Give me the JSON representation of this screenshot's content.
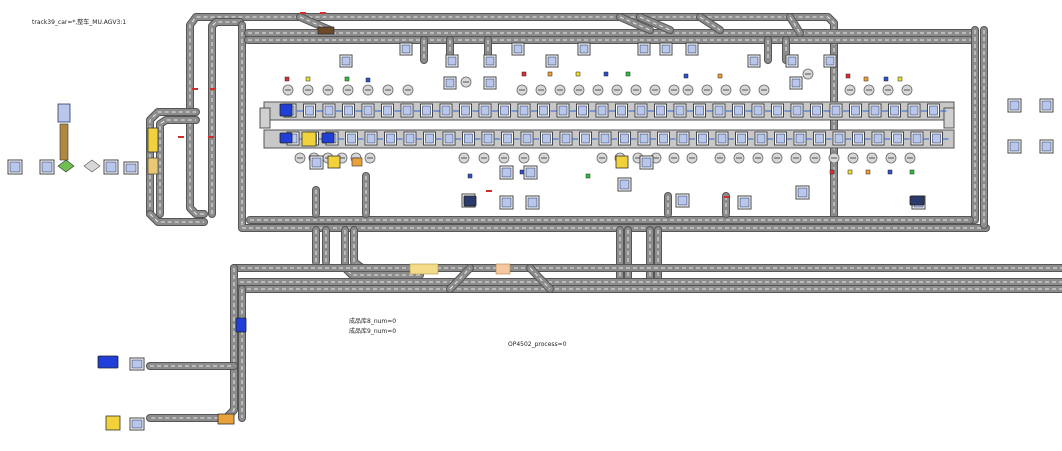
{
  "labels": {
    "top_status": "track39_car=*,整车_MU.AGV3:1",
    "counter_a": "成品库8_num=0",
    "counter_b": "成品库9_num=0",
    "process_status": "OP4502_process=0"
  },
  "colors": {
    "track_fill": "#8c8c8c",
    "track_edge": "#555555",
    "track_dash": "#e8e8e8",
    "station_fill": "#b9c7ea",
    "station_edge": "#2a3a6a",
    "conveyor_fill": "#c8c8c8",
    "agv_blue": "#1f3fd8",
    "agv_yellow": "#f2d23a",
    "flow_blue": "#2b63d6",
    "marker_red": "#d62b2b",
    "buffer_orange": "#e8a23a"
  },
  "legend_icons": [
    "station-icon",
    "agv-icon",
    "robot-icon",
    "conveyor-icon",
    "buffer-icon",
    "fixture-icon",
    "sensor-icon"
  ]
}
